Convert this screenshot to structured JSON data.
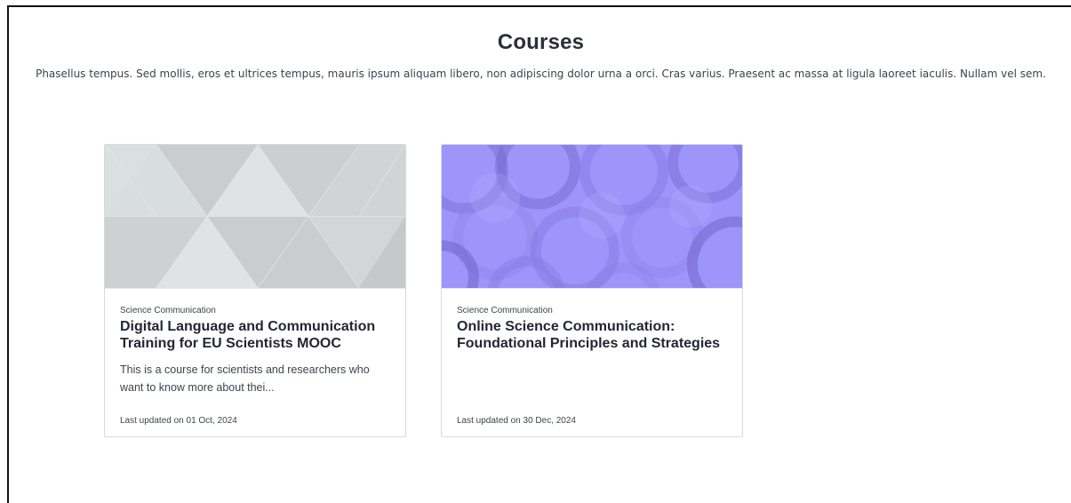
{
  "header": {
    "title": "Courses",
    "description": "Phasellus tempus. Sed mollis, eros et ultrices tempus, mauris ipsum aliquam libero, non adipiscing dolor urna a orci. Cras varius. Praesent ac massa at ligula laoreet iaculis. Nullam vel sem."
  },
  "courses": [
    {
      "category": "Science Communication",
      "title": "Digital Language and Communication Training for EU Scientists MOOC",
      "excerpt": "This is a course for scientists and researchers who want to know more about thei...",
      "updated": "Last updated on 01 Oct, 2024",
      "banner_pattern": "triangles-icon",
      "banner_color": "#d3d7da"
    },
    {
      "category": "Science Communication",
      "title": "Online Science Communication: Foundational Principles and Strategies",
      "excerpt": "",
      "updated": "Last updated on 30 Dec, 2024",
      "banner_pattern": "circles-icon",
      "banner_color": "#9a8ffb"
    }
  ]
}
